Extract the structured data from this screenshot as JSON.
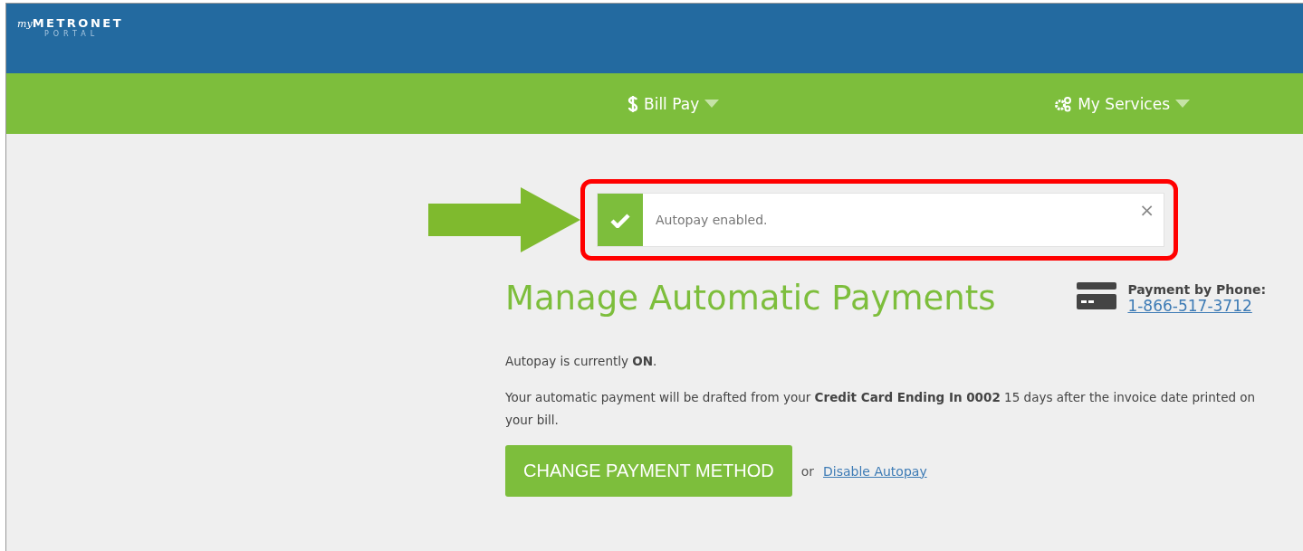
{
  "header": {
    "logo": {
      "script": "my",
      "name": "METRONET",
      "tagline": "PORTAL"
    }
  },
  "nav": [
    {
      "kind": "dollar",
      "label": "Bill Pay"
    },
    {
      "kind": "gears",
      "label": "My Services"
    }
  ],
  "alert": {
    "message": "Autopay enabled.",
    "close": "×"
  },
  "heading": "Manage Automatic Payments",
  "phone": {
    "label": "Payment by Phone:",
    "number": "1-866-517-3712"
  },
  "paragraphs": [
    "Autopay is currently **ON**.",
    "Your automatic payment will be drafted from your **Credit Card Ending In 0002** 15 days after the invoice date printed on your bill."
  ],
  "primary_button": "CHANGE PAYMENT METHOD",
  "separator": "or",
  "link": "Disable Autopay"
}
